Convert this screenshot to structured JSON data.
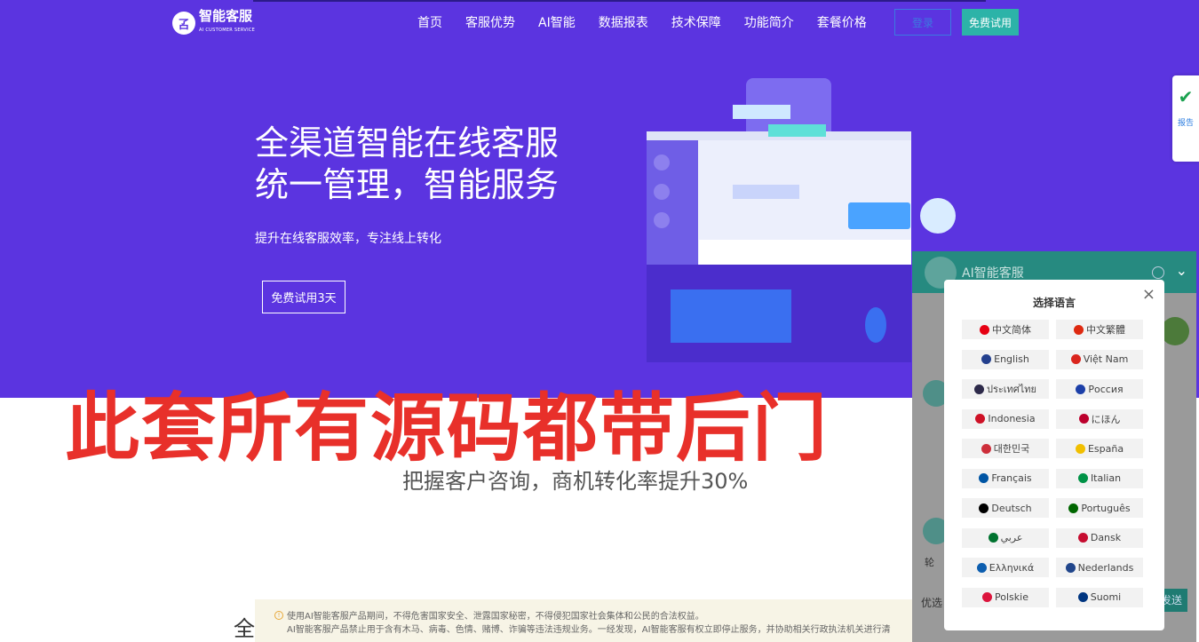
{
  "header": {
    "logo_text": "智能客服",
    "logo_sub": "AI CUSTOMER SERVICE",
    "nav": [
      "首页",
      "客服优势",
      "AI智能",
      "数据报表",
      "技术保障",
      "功能简介",
      "套餐价格"
    ],
    "login": "登录",
    "trial": "免费试用"
  },
  "hero": {
    "title_line1": "全渠道智能在线客服",
    "title_line2": "统一管理，智能服务",
    "subtitle": "提升在线客服效率，专注线上转化",
    "cta": "免费试用3天"
  },
  "side_badge": {
    "text": "报告"
  },
  "watermark": "此套所有源码都带后门",
  "section": {
    "slogan": "把握客户咨询，商机转化率提升30%",
    "heading_partial": "全"
  },
  "notice": {
    "line1": "使用AI智能客服产品期间，不得危害国家安全、泄露国家秘密，不得侵犯国家社会集体和公民的合法权益。",
    "line2": "AI智能客服产品禁止用于含有木马、病毒、色情、赌博、诈骗等违法违规业务。一经发现，AI智能客服有权立即停止服务，并协助相关行政执法机关进行清"
  },
  "chat": {
    "title": "AI智能客服",
    "pref": "优选",
    "send": "发送",
    "chip": "轮"
  },
  "language_modal": {
    "title": "选择语言",
    "close": "×",
    "languages": [
      {
        "label": "中文简体",
        "color": "#e60012"
      },
      {
        "label": "中文繁體",
        "color": "#de2910"
      },
      {
        "label": "English",
        "color": "#24408e"
      },
      {
        "label": "Việt Nam",
        "color": "#da251d"
      },
      {
        "label": "ประเทศไทย",
        "color": "#2d2a4a"
      },
      {
        "label": "Россия",
        "color": "#1c3fa8"
      },
      {
        "label": "Indonesia",
        "color": "#ce1126"
      },
      {
        "label": "にほん",
        "color": "#bc002d"
      },
      {
        "label": "대한민국",
        "color": "#cd2e3a"
      },
      {
        "label": "España",
        "color": "#f1bf00"
      },
      {
        "label": "Français",
        "color": "#0055a4"
      },
      {
        "label": "Italian",
        "color": "#009246"
      },
      {
        "label": "Deutsch",
        "color": "#000000"
      },
      {
        "label": "Português",
        "color": "#006600"
      },
      {
        "label": "عربي",
        "color": "#00732f"
      },
      {
        "label": "Dansk",
        "color": "#c60c30"
      },
      {
        "label": "Ελληνικά",
        "color": "#0d5eaf"
      },
      {
        "label": "Nederlands",
        "color": "#21468b"
      },
      {
        "label": "Polskie",
        "color": "#dc143c"
      },
      {
        "label": "Suomi",
        "color": "#003580"
      }
    ]
  }
}
